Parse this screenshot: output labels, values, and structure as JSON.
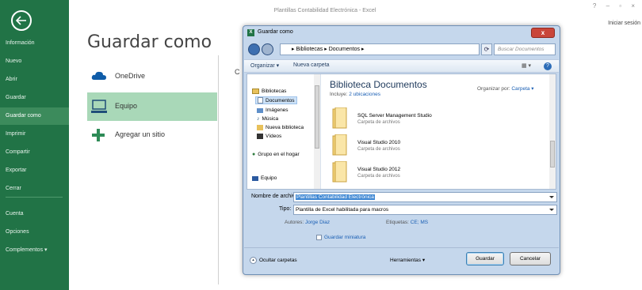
{
  "window": {
    "title": "Plantillas Contabilidad Electrónica - Excel",
    "controls": "? – ▫ ×",
    "signin": "Iniciar sesión"
  },
  "backstage": {
    "items": [
      {
        "label": "Información"
      },
      {
        "label": "Nuevo"
      },
      {
        "label": "Abrir"
      },
      {
        "label": "Guardar"
      },
      {
        "label": "Guardar como",
        "active": true
      },
      {
        "label": "Imprimir"
      },
      {
        "label": "Compartir"
      },
      {
        "label": "Exportar"
      },
      {
        "label": "Cerrar"
      },
      {
        "label": "Cuenta"
      },
      {
        "label": "Opciones"
      },
      {
        "label": "Complementos ▾"
      }
    ]
  },
  "main": {
    "title": "Guardar como",
    "places": [
      {
        "label": "OneDrive",
        "icon": "cloud-icon"
      },
      {
        "label": "Equipo",
        "icon": "computer-icon",
        "active": true
      },
      {
        "label": "Agregar un sitio",
        "icon": "plus-icon"
      }
    ],
    "peek": "C"
  },
  "dialog": {
    "title": "Guardar como",
    "close": "x",
    "address": "▸ Bibliotecas ▸ Documentos ▸",
    "search_placeholder": "Buscar Documentos",
    "toolbar": {
      "organize": "Organizar ▾",
      "new_folder": "Nueva carpeta"
    },
    "nav": [
      {
        "label": "Bibliotecas"
      },
      {
        "label": "Documentos",
        "selected": true
      },
      {
        "label": "Imágenes"
      },
      {
        "label": "Música"
      },
      {
        "label": "Nueva biblioteca"
      },
      {
        "label": "Vídeos"
      },
      {
        "label": "Grupo en el hogar"
      },
      {
        "label": "Equipo"
      }
    ],
    "library_title": "Biblioteca Documentos",
    "library_sub_prefix": "Incluye: ",
    "library_sub_link": "2 ubicaciones",
    "arrange_prefix": "Organizar por: ",
    "arrange_value": "Carpeta ▾",
    "folders": [
      {
        "name": "SQL Server Management Studio",
        "type": "Carpeta de archivos"
      },
      {
        "name": "Visual Studio 2010",
        "type": "Carpeta de archivos"
      },
      {
        "name": "Visual Studio 2012",
        "type": "Carpeta de archivos"
      }
    ],
    "filename_label": "Nombre de archivo:",
    "filename_value": "Plantillas Contabilidad Electrónica",
    "type_label": "Tipo:",
    "type_value": "Plantilla de Excel habilitada para macros",
    "authors_label": "Autores:",
    "authors_value": "Jorge Diaz",
    "tags_label": "Etiquetas:",
    "tags_value": "CE; MS",
    "thumbnail_label": "Guardar miniatura",
    "hide_folders": "Ocultar carpetas",
    "tools": "Herramientas  ▾",
    "save": "Guardar",
    "cancel": "Cancelar"
  },
  "colors": {
    "excel_green": "#217346",
    "active_place": "#a9d8b8",
    "dialog_frame": "#c5d7ec"
  }
}
